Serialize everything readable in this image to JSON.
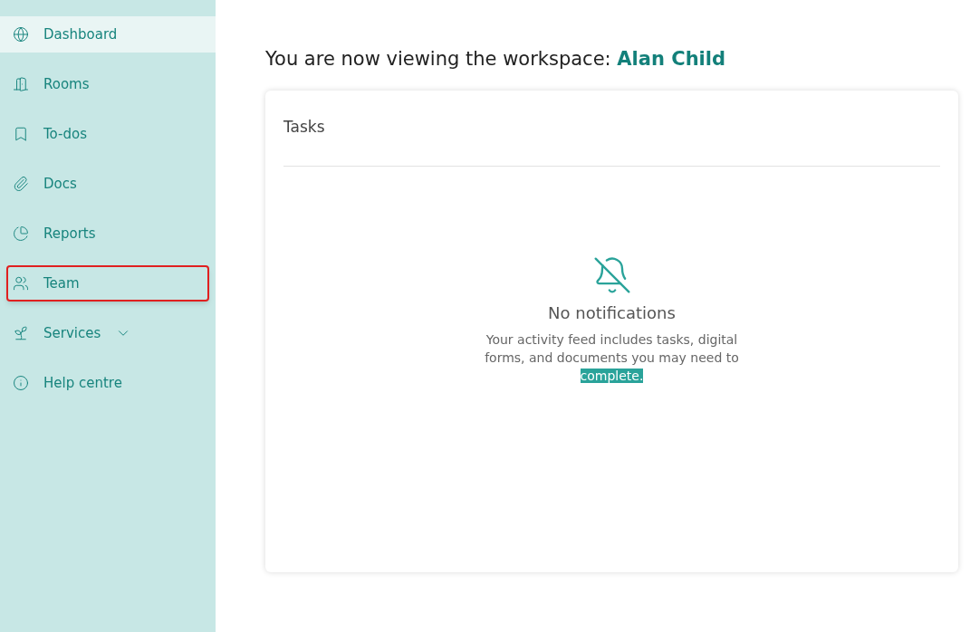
{
  "sidebar": {
    "items": [
      {
        "label": "Dashboard",
        "kind": "link",
        "selected": true,
        "highlighted": false
      },
      {
        "label": "Rooms",
        "kind": "link",
        "selected": false,
        "highlighted": false
      },
      {
        "label": "To-dos",
        "kind": "link",
        "selected": false,
        "highlighted": false
      },
      {
        "label": "Docs",
        "kind": "link",
        "selected": false,
        "highlighted": false
      },
      {
        "label": "Reports",
        "kind": "link",
        "selected": false,
        "highlighted": false
      },
      {
        "label": "Team",
        "kind": "link",
        "selected": false,
        "highlighted": true
      },
      {
        "label": "Services",
        "kind": "group",
        "selected": false,
        "highlighted": false
      },
      {
        "label": "Help centre",
        "kind": "link",
        "selected": false,
        "highlighted": false
      }
    ]
  },
  "heading": {
    "text": "You are now viewing the workspace:",
    "workspace": "Alan Child"
  },
  "tasks_card": {
    "title": "Tasks",
    "empty_title": "No notifications",
    "empty_text": "Your activity feed includes tasks, digital forms, and documents you may need to",
    "empty_text_selected": "complete."
  }
}
